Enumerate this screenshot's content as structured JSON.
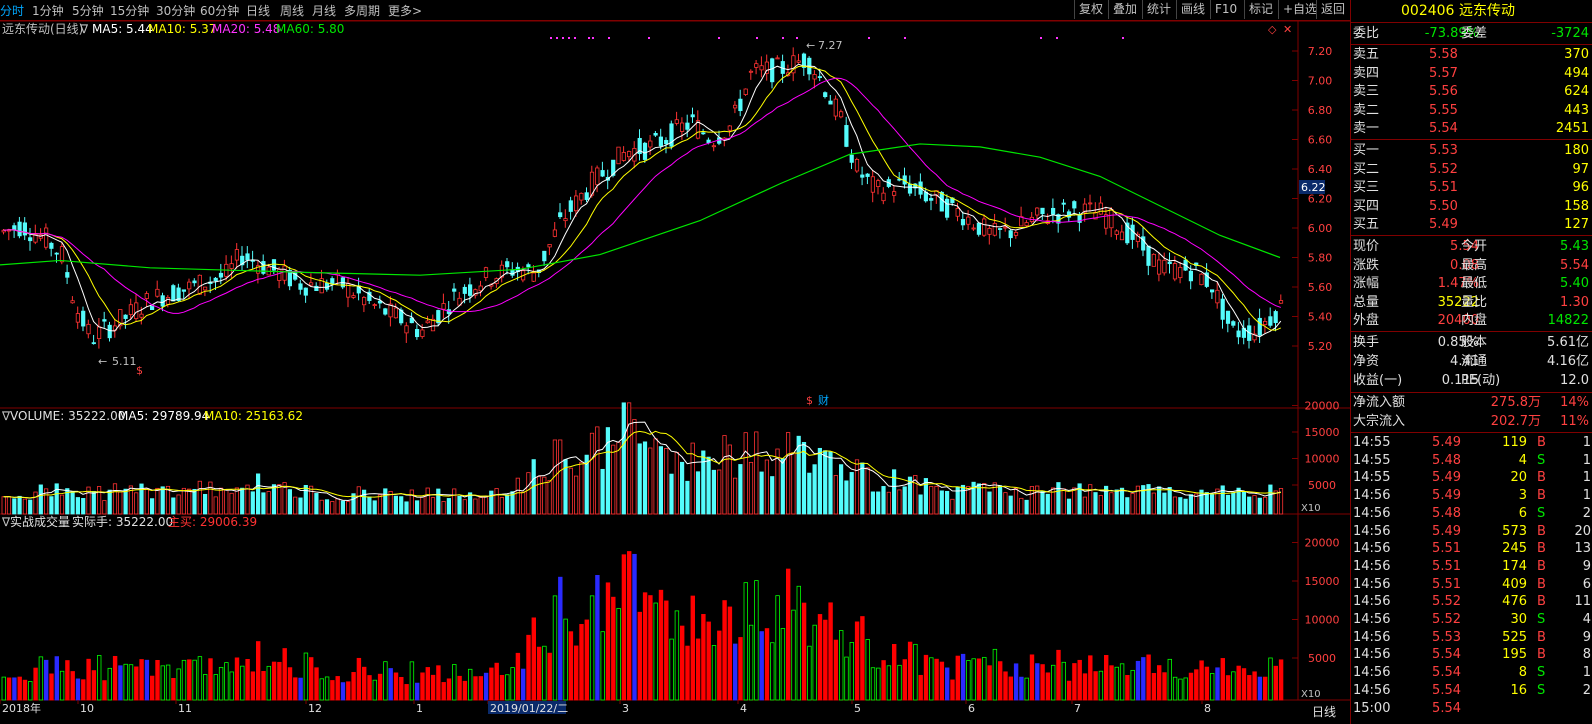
{
  "toolbar": {
    "tabs": [
      "分时",
      "1分钟",
      "5分钟",
      "15分钟",
      "30分钟",
      "60分钟",
      "日线",
      "周线",
      "月线",
      "多周期",
      "更多>"
    ],
    "buttons": [
      "复权",
      "叠加",
      "统计",
      "画线",
      "F10",
      "标记",
      "+自选",
      "返回"
    ]
  },
  "main_chart": {
    "title": "远东传动(日线)",
    "indicator": "∇",
    "ma5_label": "MA5: 5.44",
    "ma10_label": "MA10: 5.37",
    "ma20_label": "MA20: 5.48",
    "ma60_label": "MA60: 5.80",
    "high_marker": "7.27",
    "low_marker": "5.11",
    "current_price_tag": "6.22",
    "y_ticks": [
      "7.20",
      "7.00",
      "6.80",
      "6.60",
      "6.40",
      "6.20",
      "6.00",
      "5.80",
      "5.60",
      "5.40",
      "5.20"
    ],
    "fin_marker": "财",
    "dollar_marker": "$",
    "colors": {
      "up": "#ff3232",
      "down": "#54fcfc",
      "ma5": "#ffffff",
      "ma10": "#ffff00",
      "ma20": "#ff00ff",
      "ma60": "#00e600",
      "grid": "#800000"
    }
  },
  "volume_chart": {
    "title": "VOLUME: 35222.00",
    "ma5_label": "MA5: 29789.94",
    "ma10_label": "MA10: 25163.62",
    "y_ticks": [
      "20000",
      "15000",
      "10000",
      "5000"
    ],
    "multiplier": "X10"
  },
  "actual_chart": {
    "title": "实战成交量",
    "actual_label": "实际手: 35222.00",
    "main_label": "主买: 29006.39",
    "y_ticks": [
      "20000",
      "15000",
      "10000",
      "5000"
    ],
    "multiplier": "X10"
  },
  "x_axis": {
    "labels": [
      "2018年",
      "10",
      "11",
      "12",
      "1",
      "2019/01/22/二",
      "3",
      "4",
      "5",
      "6",
      "7",
      "8"
    ],
    "period": "日线"
  },
  "quote": {
    "code": "002406",
    "name": "远东传动",
    "weibi_label": "委比",
    "weibi": "-73.89%",
    "weicha_label": "委差",
    "weicha": "-3724",
    "asks": [
      {
        "label": "卖五",
        "price": "5.58",
        "vol": "370"
      },
      {
        "label": "卖四",
        "price": "5.57",
        "vol": "494"
      },
      {
        "label": "卖三",
        "price": "5.56",
        "vol": "624"
      },
      {
        "label": "卖二",
        "price": "5.55",
        "vol": "443"
      },
      {
        "label": "卖一",
        "price": "5.54",
        "vol": "2451"
      }
    ],
    "bids": [
      {
        "label": "买一",
        "price": "5.53",
        "vol": "180"
      },
      {
        "label": "买二",
        "price": "5.52",
        "vol": "97"
      },
      {
        "label": "买三",
        "price": "5.51",
        "vol": "96"
      },
      {
        "label": "买四",
        "price": "5.50",
        "vol": "158"
      },
      {
        "label": "买五",
        "price": "5.49",
        "vol": "127"
      }
    ],
    "stats": [
      {
        "l1": "现价",
        "v1": "5.54",
        "l2": "今开",
        "v2": "5.43"
      },
      {
        "l1": "涨跌",
        "v1": "0.08",
        "l2": "最高",
        "v2": "5.54"
      },
      {
        "l1": "涨幅",
        "v1": "1.47%",
        "l2": "最低",
        "v2": "5.40"
      },
      {
        "l1": "总量",
        "v1": "35222",
        "l2": "量比",
        "v2": "1.30"
      },
      {
        "l1": "外盘",
        "v1": "20400",
        "l2": "内盘",
        "v2": "14822"
      }
    ],
    "stats2": [
      {
        "l1": "换手",
        "v1": "0.85%",
        "l2": "股本",
        "v2": "5.61亿"
      },
      {
        "l1": "净资",
        "v1": "4.41",
        "l2": "流通",
        "v2": "4.16亿"
      },
      {
        "l1": "收益(一)",
        "v1": "0.115",
        "l2": "PE(动)",
        "v2": "12.0"
      }
    ],
    "flow": [
      {
        "label": "净流入额",
        "value": "275.8万",
        "pct": "14%"
      },
      {
        "label": "大宗流入",
        "value": "202.7万",
        "pct": "11%"
      }
    ],
    "ticks": [
      {
        "t": "14:55",
        "p": "5.49",
        "v": "119",
        "s": "B",
        "n": "1"
      },
      {
        "t": "14:55",
        "p": "5.48",
        "v": "4",
        "s": "S",
        "n": "1"
      },
      {
        "t": "14:55",
        "p": "5.49",
        "v": "20",
        "B": "",
        "s": "B",
        "n": "1"
      },
      {
        "t": "14:56",
        "p": "5.49",
        "v": "3",
        "s": "B",
        "n": "1"
      },
      {
        "t": "14:56",
        "p": "5.48",
        "v": "6",
        "s": "S",
        "n": "2"
      },
      {
        "t": "14:56",
        "p": "5.49",
        "v": "573",
        "s": "B",
        "n": "20"
      },
      {
        "t": "14:56",
        "p": "5.51",
        "v": "245",
        "s": "B",
        "n": "13"
      },
      {
        "t": "14:56",
        "p": "5.51",
        "v": "174",
        "s": "B",
        "n": "9"
      },
      {
        "t": "14:56",
        "p": "5.51",
        "v": "409",
        "s": "B",
        "n": "6"
      },
      {
        "t": "14:56",
        "p": "5.52",
        "v": "476",
        "s": "B",
        "n": "11"
      },
      {
        "t": "14:56",
        "p": "5.52",
        "v": "30",
        "s": "S",
        "n": "4"
      },
      {
        "t": "14:56",
        "p": "5.53",
        "v": "525",
        "s": "B",
        "n": "9"
      },
      {
        "t": "14:56",
        "p": "5.54",
        "v": "195",
        "s": "B",
        "n": "8"
      },
      {
        "t": "14:56",
        "p": "5.54",
        "v": "8",
        "s": "S",
        "n": "1"
      },
      {
        "t": "14:56",
        "p": "5.54",
        "v": "16",
        "s": "S",
        "n": "2"
      },
      {
        "t": "15:00",
        "p": "5.54",
        "v": "",
        "s": "",
        "n": ""
      }
    ]
  }
}
